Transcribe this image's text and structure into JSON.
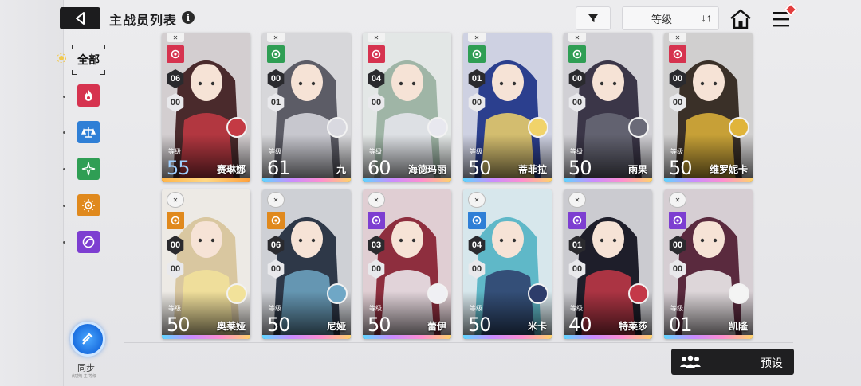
{
  "header": {
    "title": "主战员列表",
    "info": "i"
  },
  "toolbar": {
    "sort_label": "等级",
    "sort_icon": "↓↑"
  },
  "sidebar": {
    "all_label": "全部",
    "filters": [
      {
        "name": "fire-element-icon",
        "color": "#d6334f"
      },
      {
        "name": "balance-element-icon",
        "color": "#2f7fd6"
      },
      {
        "name": "wind-element-icon",
        "color": "#2f9e54"
      },
      {
        "name": "sun-element-icon",
        "color": "#e0891d"
      },
      {
        "name": "void-element-icon",
        "color": "#7d3ed1"
      }
    ]
  },
  "sync": {
    "label": "同步",
    "sub": "(切换) 主 等级"
  },
  "preset": {
    "label": "预设"
  },
  "cards": {
    "level_label": "等级",
    "row1": [
      {
        "name": "赛琳娜",
        "level": "55",
        "stat1": "06",
        "stat2": "00",
        "elem_color": "#d6334f",
        "art": "#4a2a2c",
        "accent": "#c43a44",
        "gold": true
      },
      {
        "name": "九",
        "level": "61",
        "stat1": "00",
        "stat2": "01",
        "elem_color": "#2f9e54",
        "art": "#5c5c66",
        "accent": "#d9d9e0",
        "gold": false
      },
      {
        "name": "海德玛丽",
        "level": "60",
        "stat1": "04",
        "stat2": "00",
        "elem_color": "#d6334f",
        "art": "#9fb5a6",
        "accent": "#e8e8ef",
        "gold": false
      },
      {
        "name": "蒂菲拉",
        "level": "50",
        "stat1": "01",
        "stat2": "00",
        "elem_color": "#2f9e54",
        "art": "#2b3f8e",
        "accent": "#f1d36a",
        "gold": false
      },
      {
        "name": "雨果",
        "level": "50",
        "stat1": "00",
        "stat2": "00",
        "elem_color": "#2f9e54",
        "art": "#3b3648",
        "accent": "#6a6a78",
        "gold": false
      },
      {
        "name": "维罗妮卡",
        "level": "50",
        "stat1": "00",
        "stat2": "00",
        "elem_color": "#d6334f",
        "art": "#3a3028",
        "accent": "#e0b43a",
        "gold": false
      }
    ],
    "row2": [
      {
        "name": "奥莱娅",
        "level": "50",
        "stat1": "00",
        "stat2": "00",
        "elem_color": "#e0891d",
        "art": "#d9c7a0",
        "accent": "#f2e29a",
        "gold": false
      },
      {
        "name": "尼娅",
        "level": "50",
        "stat1": "06",
        "stat2": "00",
        "elem_color": "#e0891d",
        "art": "#2e3848",
        "accent": "#6fa7c6",
        "gold": false
      },
      {
        "name": "蕾伊",
        "level": "50",
        "stat1": "03",
        "stat2": "00",
        "elem_color": "#7d3ed1",
        "art": "#8e2e3e",
        "accent": "#f0f0f4",
        "gold": false
      },
      {
        "name": "米卡",
        "level": "50",
        "stat1": "04",
        "stat2": "00",
        "elem_color": "#2f7fd6",
        "art": "#5fb8c8",
        "accent": "#2d3c6a",
        "gold": false
      },
      {
        "name": "特莱莎",
        "level": "40",
        "stat1": "01",
        "stat2": "00",
        "elem_color": "#7d3ed1",
        "art": "#1e1e2a",
        "accent": "#c43848",
        "gold": false
      },
      {
        "name": "凯隆",
        "level": "01",
        "stat1": "00",
        "stat2": "00",
        "elem_color": "#7d3ed1",
        "art": "#5a2a3e",
        "accent": "#f4f4f4",
        "gold": false
      }
    ]
  }
}
